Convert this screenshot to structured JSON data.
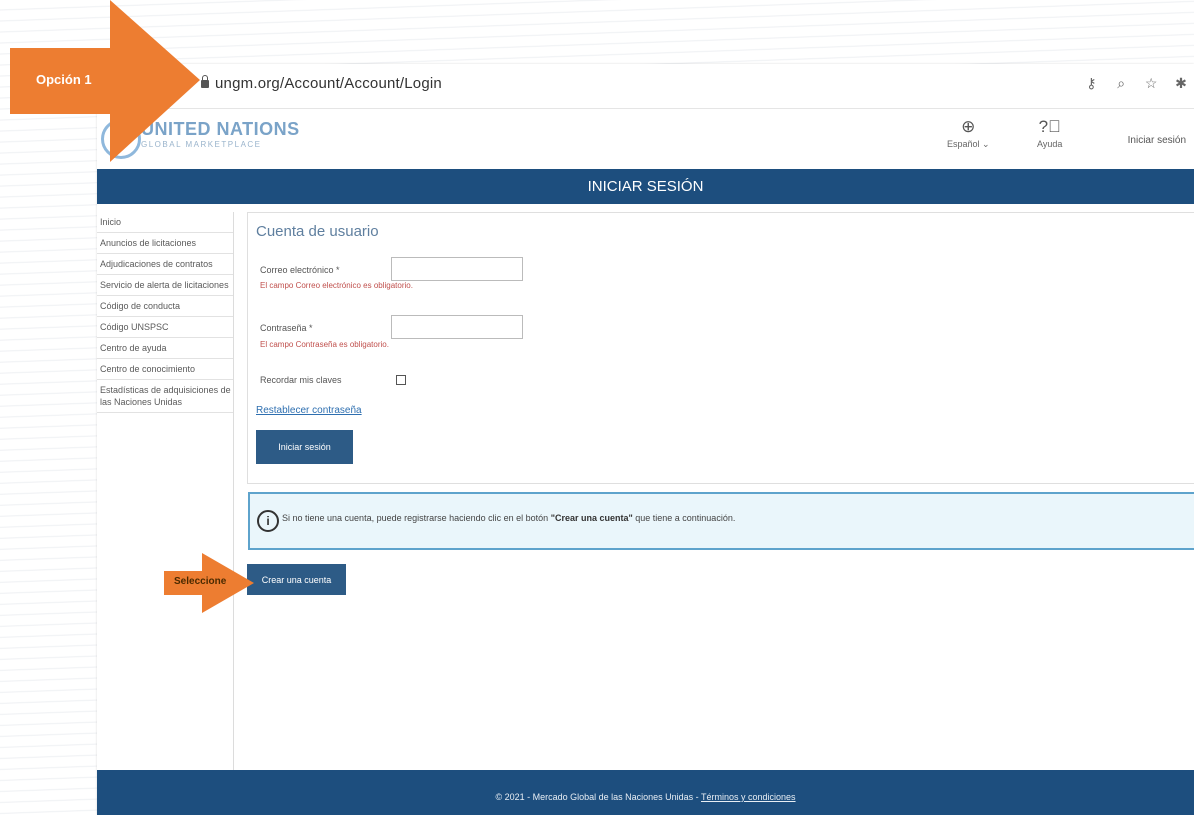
{
  "browser": {
    "url": "ungm.org/Account/Account/Login"
  },
  "header": {
    "logo_title": "UNITED NATIONS",
    "logo_subtitle": "GLOBAL MARKETPLACE",
    "language_label": "Español",
    "help_label": "Ayuda",
    "login_link": "Iniciar sesión"
  },
  "title_bar": "INICIAR SESIÓN",
  "sidebar": {
    "items": [
      "Inicio",
      "Anuncios de licitaciones",
      "Adjudicaciones de contratos",
      "Servicio de alerta de licitaciones",
      "Código de conducta",
      "Código UNSPSC",
      "Centro de ayuda",
      "Centro de conocimiento",
      "Estadísticas de adquisiciones de las Naciones Unidas"
    ]
  },
  "form": {
    "title": "Cuenta de usuario",
    "email_label": "Correo electrónico *",
    "email_value": "",
    "email_error": "El campo Correo electrónico es obligatorio.",
    "password_label": "Contraseña *",
    "password_value": "",
    "password_error": "El campo Contraseña es obligatorio.",
    "remember_label": "Recordar mis claves",
    "remember_checked": false,
    "reset_link": "Restablecer contraseña",
    "login_button": "Iniciar sesión"
  },
  "info": {
    "text_before": "Si no tiene una cuenta, puede registrarse haciendo clic en el botón ",
    "text_bold": "\"Crear una cuenta\"",
    "text_after": " que tiene a continuación."
  },
  "create_account_button": "Crear una cuenta",
  "footer": {
    "text": "© 2021 - Mercado Global de las Naciones Unidas - ",
    "link": "Términos y condiciones"
  },
  "annotations": {
    "option_label": "Opción 1",
    "select_label": "Seleccione",
    "arrow_color": "#ed7d31"
  }
}
